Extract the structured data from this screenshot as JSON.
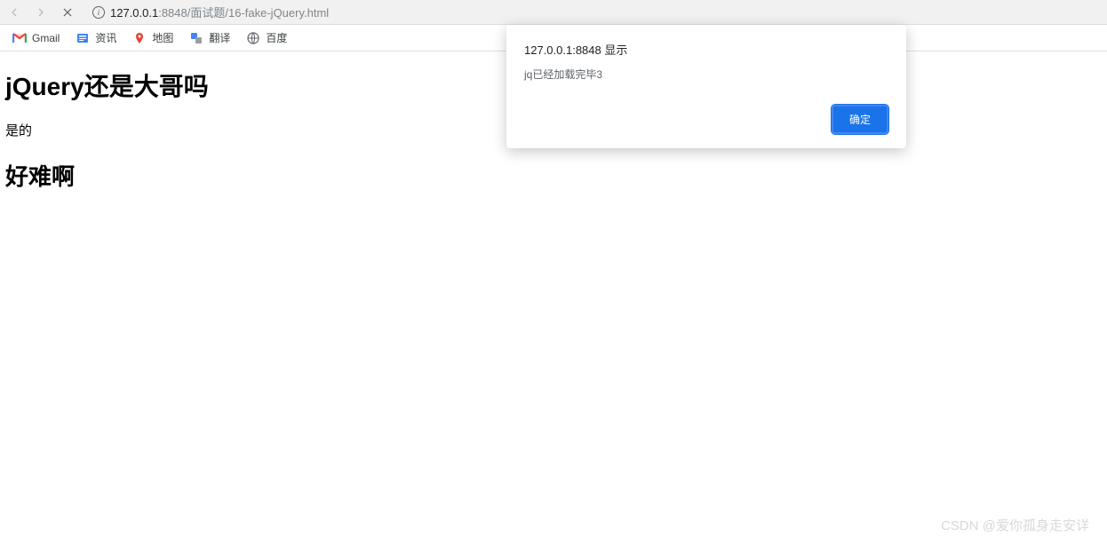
{
  "toolbar": {
    "url_host": "127.0.0.1",
    "url_port": ":8848",
    "url_path": "/面试题/16-fake-jQuery.html"
  },
  "bookmarks": [
    {
      "label": "Gmail",
      "icon": "gmail"
    },
    {
      "label": "资讯",
      "icon": "news"
    },
    {
      "label": "地图",
      "icon": "maps"
    },
    {
      "label": "翻译",
      "icon": "translate"
    },
    {
      "label": "百度",
      "icon": "baidu"
    }
  ],
  "page": {
    "heading1": "jQuery还是大哥吗",
    "paragraph": "是的",
    "heading2": "好难啊"
  },
  "dialog": {
    "title": "127.0.0.1:8848 显示",
    "message": "jq已经加载完毕3",
    "ok_label": "确定"
  },
  "watermark": "CSDN @爱你孤身走安详"
}
